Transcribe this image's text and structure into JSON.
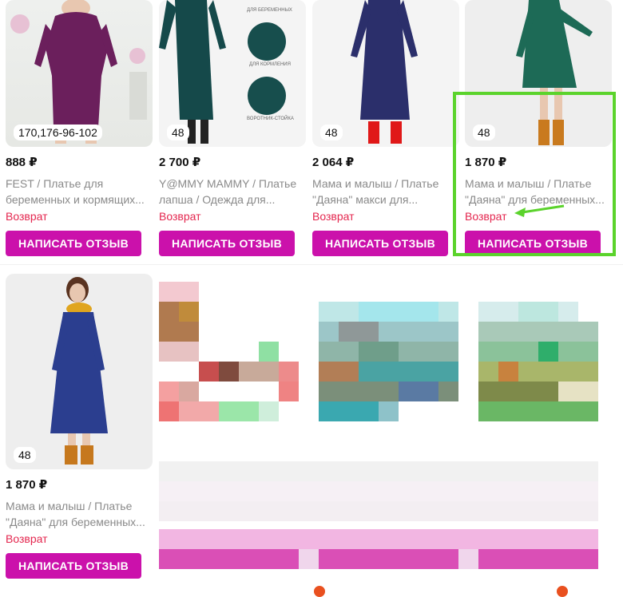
{
  "colors": {
    "accent": "#cb11ab",
    "return_text": "#e4264e",
    "highlight": "#5bd32c"
  },
  "products": [
    {
      "size": "170,176-96-102",
      "price": "888 ₽",
      "title": "FEST / Платье для беременных и кормящих...",
      "status": "Возврат",
      "button": "НАПИСАТЬ ОТЗЫВ"
    },
    {
      "size": "48",
      "price": "2 700 ₽",
      "title": "Y@MMY MAMMY / Платье лапша / Одежда для...",
      "status": "Возврат",
      "button": "НАПИСАТЬ ОТЗЫВ",
      "image_labels": [
        "ДЛЯ БЕРЕМЕННЫХ",
        "ДЛЯ КОРМЛЕНИЯ",
        "ВОРОТНИК-СТОЙКА"
      ]
    },
    {
      "size": "48",
      "price": "2 064 ₽",
      "title": "Мама и малыш / Платье \"Даяна\" макси для...",
      "status": "Возврат",
      "button": "НАПИСАТЬ ОТЗЫВ"
    },
    {
      "size": "48",
      "price": "1 870 ₽",
      "title": "Мама и малыш / Платье \"Даяна\" для беременных...",
      "status": "Возврат",
      "button": "НАПИСАТЬ ОТЗЫВ"
    },
    {
      "size": "48",
      "price": "1 870 ₽",
      "title": "Мама и малыш / Платье \"Даяна\" для беременных...",
      "status": "Возврат",
      "button": "НАПИСАТЬ ОТЗЫВ"
    }
  ]
}
